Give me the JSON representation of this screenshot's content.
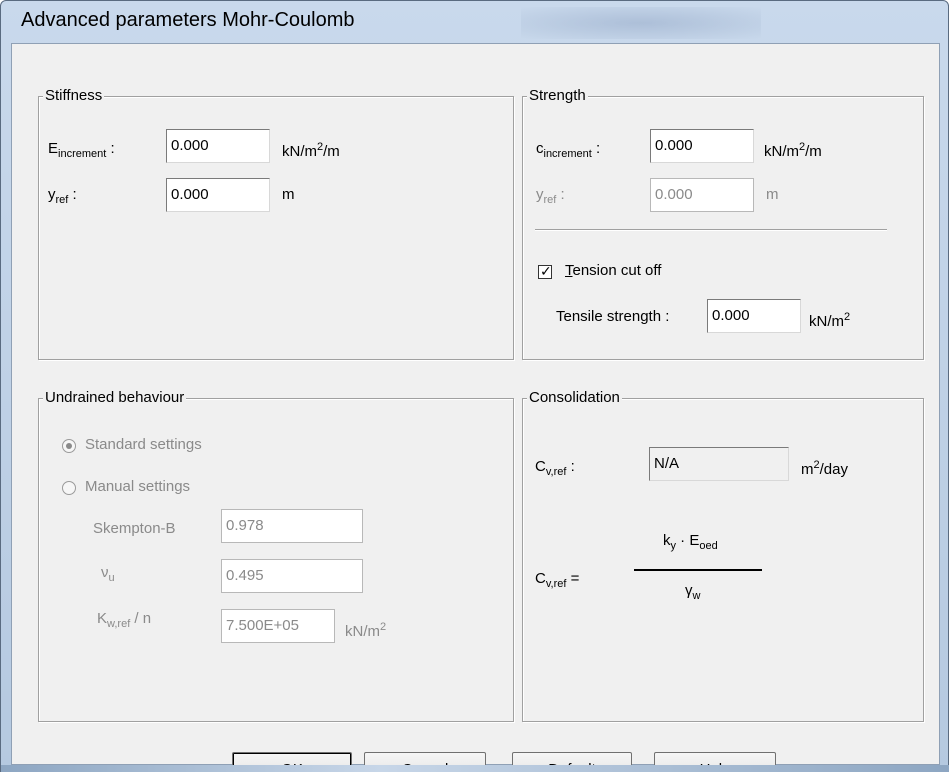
{
  "window": {
    "title": "Advanced parameters Mohr-Coulomb"
  },
  "stiffness": {
    "group_label": "Stiffness",
    "e_increment": {
      "label_main": "E",
      "label_sub": "increment",
      "label_tail": " :",
      "value": "0.000",
      "unit_pre": "kN",
      "unit_sep": "/",
      "unit_mid": "m",
      "unit_sup": "2",
      "unit_post": "/m"
    },
    "y_ref": {
      "label_main": "y",
      "label_sub": "ref",
      "label_tail": " :",
      "value": "0.000",
      "unit": "m"
    }
  },
  "strength": {
    "group_label": "Strength",
    "c_increment": {
      "label_main": "c",
      "label_sub": "increment",
      "label_tail": " :",
      "value": "0.000",
      "unit_pre": "kN",
      "unit_sep": "/",
      "unit_mid": "m",
      "unit_sup": "2",
      "unit_post": "/m"
    },
    "y_ref": {
      "label_main": "y",
      "label_sub": "ref",
      "label_tail": " :",
      "value": "0.000",
      "unit": "m"
    },
    "tension_cut_off": {
      "label_first": "T",
      "label_rest": "ension cut off",
      "checked": true
    },
    "tensile_strength": {
      "label": "Tensile strength :",
      "value": "0.000",
      "unit_pre": "kN",
      "unit_sep": "/",
      "unit_mid": "m",
      "unit_sup": "2"
    }
  },
  "undrained": {
    "group_label": "Undrained behaviour",
    "standard_settings": "Standard settings",
    "manual_settings": "Manual settings",
    "skempton": {
      "label": "Skempton-B",
      "value": "0.978"
    },
    "nu_u": {
      "label_main": "ν",
      "label_sub": "u",
      "value": "0.495"
    },
    "kw_ref": {
      "label_main": "K",
      "label_sub": "w,ref",
      "label_tail": " / n",
      "value": "7.500E+05",
      "unit_pre": "kN",
      "unit_sep": "/",
      "unit_mid": "m",
      "unit_sup": "2"
    }
  },
  "consolidation": {
    "group_label": "Consolidation",
    "cv_ref": {
      "label_main": "C",
      "label_sub": "v,ref",
      "label_tail": " :",
      "value": "N/A",
      "unit_mid": "m",
      "unit_sup": "2",
      "unit_post": "/day"
    },
    "formula": {
      "lhs_main": "C",
      "lhs_sub": "v,ref",
      "lhs_eq": " =",
      "num_k": "k",
      "num_k_sub": "y",
      "num_dot": " · ",
      "num_e": "E",
      "num_e_sub": "oed",
      "den_main": "γ",
      "den_sub": "w"
    }
  },
  "buttons": {
    "ok_first": "O",
    "ok_rest": "K",
    "cancel_first": "C",
    "cancel_rest": "ancel",
    "default_first": "D",
    "default_rest": "efault",
    "help_first": "H",
    "help_rest": "elp"
  }
}
